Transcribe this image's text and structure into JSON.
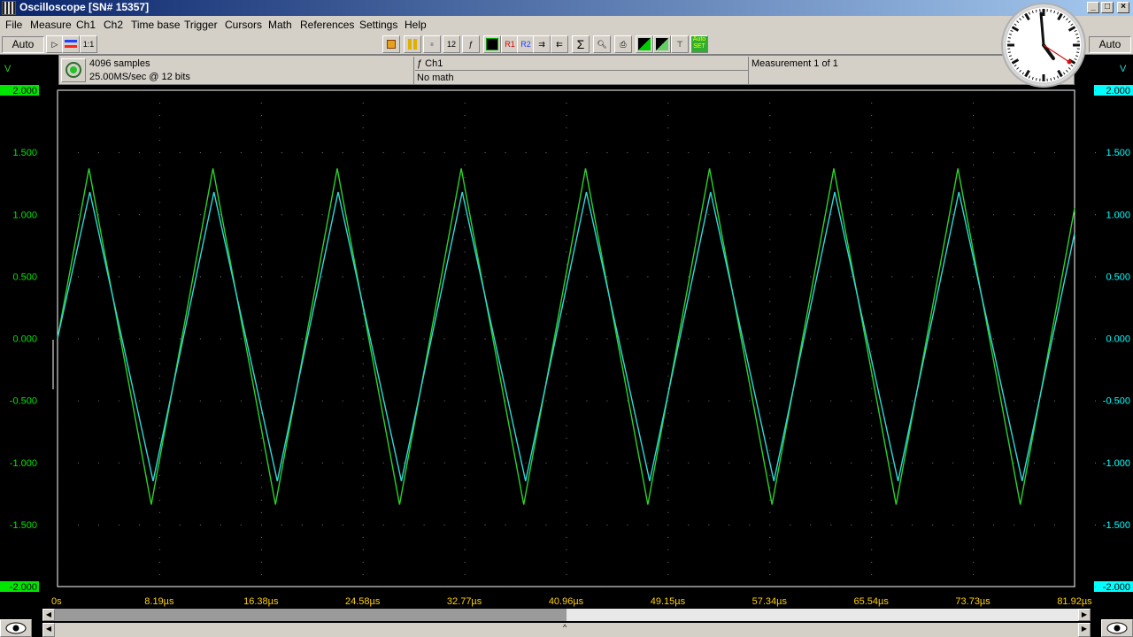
{
  "window": {
    "title": "Oscilloscope  [SN# 15357]"
  },
  "menu": [
    "File",
    "Measure",
    "Ch1",
    "Ch2",
    "Time base",
    "Trigger",
    "Cursors",
    "Math",
    "References",
    "Settings",
    "Help"
  ],
  "toolbar": {
    "left_mode": "Auto",
    "right_mode": "Auto",
    "ratio_label": "1:1",
    "sum_label": "Σ",
    "r1": "R1",
    "r2": "R2",
    "autoset": "Auto SET"
  },
  "info": {
    "samples": "4096 samples",
    "rate": "25.00MS/sec @ 12 bits",
    "channel": "ƒ Ch1",
    "math": "No math",
    "measurement": "Measurement 1 of 1"
  },
  "axis": {
    "unit": "V",
    "y_ticks": [
      "2.000",
      "1.500",
      "1.000",
      "0.500",
      "0.000",
      "-0.500",
      "-1.000",
      "-1.500",
      "-2.000"
    ],
    "x_ticks": [
      "0s",
      "8.19µs",
      "16.38µs",
      "24.58µs",
      "32.77µs",
      "40.96µs",
      "49.15µs",
      "57.34µs",
      "65.54µs",
      "73.73µs",
      "81.92µs"
    ]
  },
  "colors": {
    "ch1": "#2ad22a",
    "ch2": "#2fd8d8",
    "ch1_badge": "#00e600",
    "ch2_badge": "#00ffff",
    "tick_text": "#ffd000",
    "grid_dot": "#7a7a7a"
  },
  "chart_data": {
    "type": "line",
    "xlabel": "",
    "ylabel": "V",
    "xlim": [
      0,
      81.92
    ],
    "ylim": [
      -2.0,
      2.0
    ],
    "grid": true,
    "series": [
      {
        "x": [
          0,
          2.53,
          7.55,
          12.52,
          17.55,
          22.53,
          27.55,
          32.52,
          37.55,
          42.53,
          47.55,
          52.52,
          57.55,
          62.53,
          67.55,
          72.52,
          77.55,
          81.92
        ],
        "y": [
          0.0,
          1.37,
          -1.34,
          1.37,
          -1.34,
          1.37,
          -1.34,
          1.37,
          -1.34,
          1.37,
          -1.34,
          1.37,
          -1.34,
          1.37,
          -1.34,
          1.37,
          -1.34,
          1.05
        ]
      },
      {
        "x": [
          0,
          2.6,
          7.7,
          12.6,
          17.7,
          22.6,
          27.7,
          32.6,
          37.7,
          42.6,
          47.7,
          52.6,
          57.7,
          62.6,
          67.7,
          72.6,
          77.7,
          81.92
        ],
        "y": [
          0.0,
          1.18,
          -1.15,
          1.18,
          -1.15,
          1.18,
          -1.15,
          1.18,
          -1.15,
          1.18,
          -1.15,
          1.18,
          -1.15,
          1.18,
          -1.15,
          1.18,
          -1.15,
          0.85
        ]
      }
    ]
  }
}
